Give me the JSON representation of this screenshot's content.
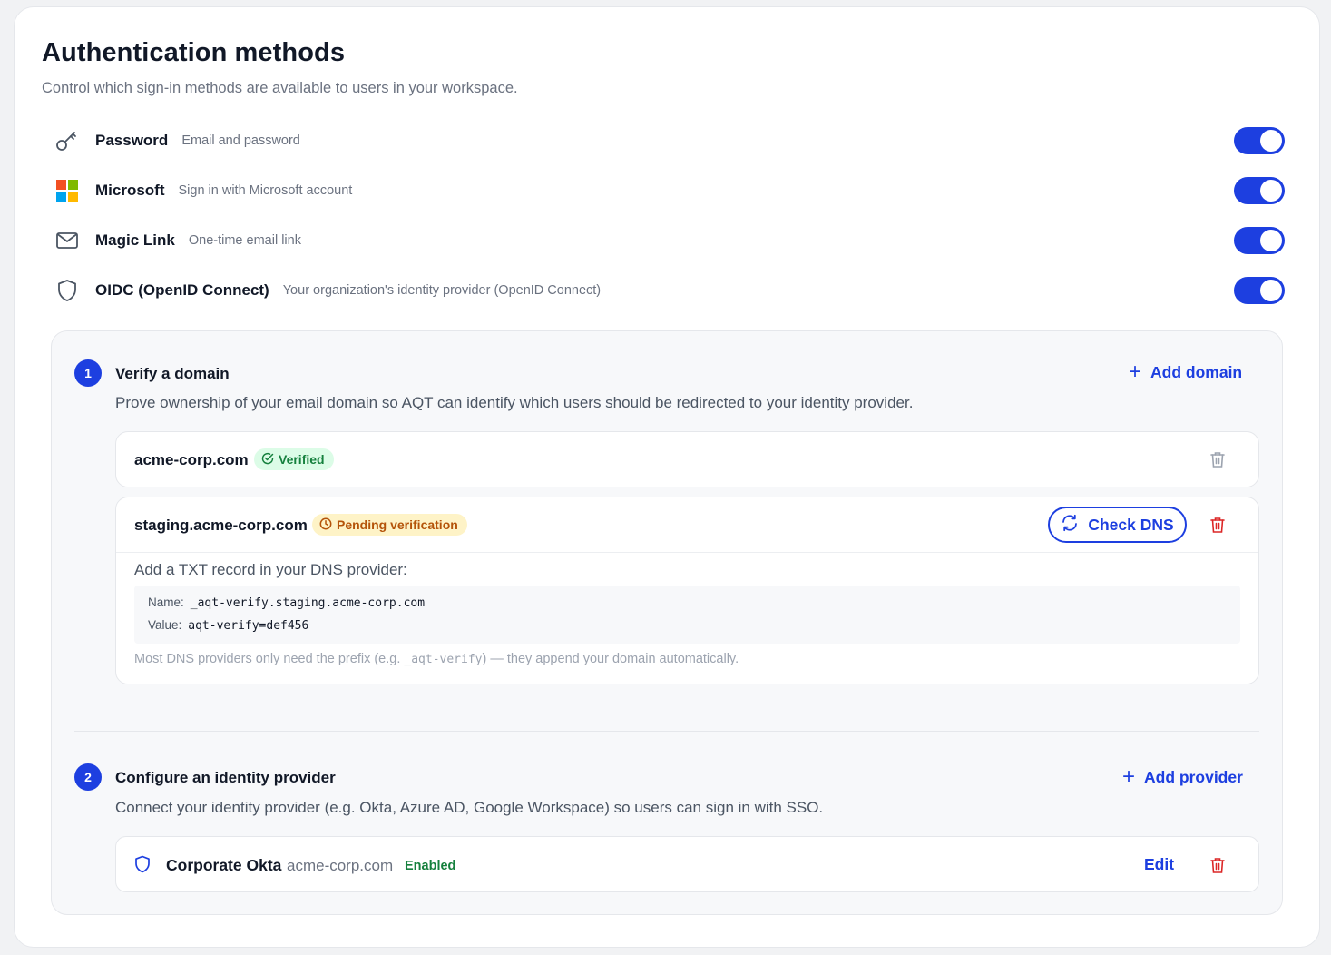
{
  "page": {
    "title": "Authentication methods",
    "subtitle": "Control which sign-in methods are available to users in your workspace."
  },
  "methods": [
    {
      "name": "Password",
      "description": "Email and password",
      "icon": "key-icon",
      "enabled": true
    },
    {
      "name": "Microsoft",
      "description": "Sign in with Microsoft account",
      "icon": "microsoft-logo-icon",
      "enabled": true
    },
    {
      "name": "Magic Link",
      "description": "One-time email link",
      "icon": "mail-icon",
      "enabled": true
    },
    {
      "name": "OIDC (OpenID Connect)",
      "description": "Your organization's identity provider (OpenID Connect)",
      "icon": "shield-icon",
      "enabled": true
    }
  ],
  "oidc": {
    "step1": {
      "number": "1",
      "title": "Verify a domain",
      "description": "Prove ownership of your email domain so AQT can identify which users should be redirected to your identity provider.",
      "add_label": "Add domain",
      "domains": [
        {
          "name": "acme-corp.com",
          "status": "Verified"
        },
        {
          "name": "staging.acme-corp.com",
          "status": "Pending verification",
          "check_label": "Check DNS",
          "instruction": "Add a TXT record in your DNS provider:",
          "record_name_label": "Name:",
          "record_name": "_aqt-verify.staging.acme-corp.com",
          "record_value_label": "Value:",
          "record_value": "aqt-verify=def456",
          "hint_before": "Most DNS providers only need the prefix (e.g. ",
          "hint_code": "_aqt-verify",
          "hint_after": ") — they append your domain automatically."
        }
      ]
    },
    "step2": {
      "number": "2",
      "title": "Configure an identity provider",
      "description": "Connect your identity provider (e.g. Okta, Azure AD, Google Workspace) so users can sign in with SSO.",
      "add_label": "Add provider",
      "providers": [
        {
          "name": "Corporate Okta",
          "domain": "acme-corp.com",
          "status": "Enabled",
          "edit_label": "Edit"
        }
      ]
    }
  },
  "colors": {
    "accent": "#1d3fe0",
    "verified": "#15803d",
    "pending": "#b45309",
    "danger": "#dc2626"
  }
}
